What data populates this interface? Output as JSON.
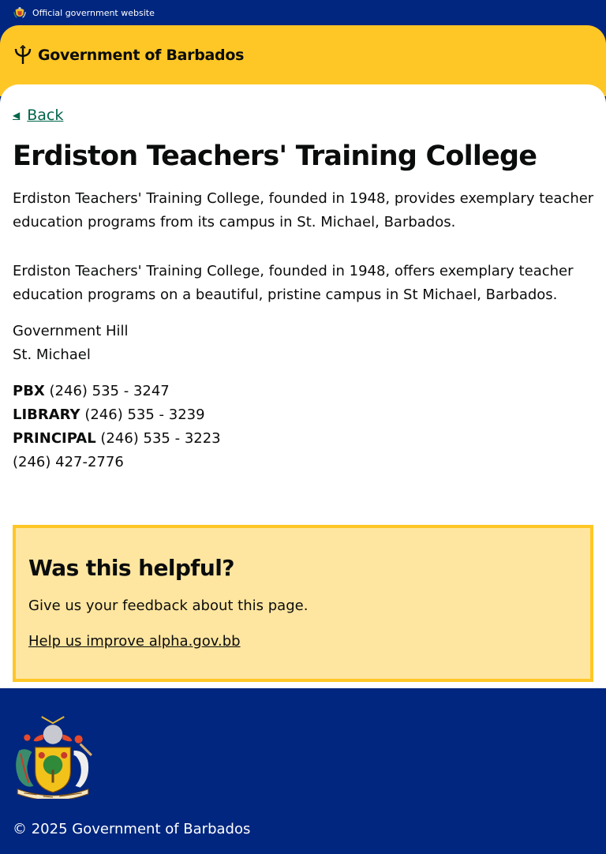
{
  "topbar": {
    "label": "Official government website",
    "icon": "coat-of-arms-icon"
  },
  "header": {
    "brand": "Government of Barbados",
    "icon": "trident-icon"
  },
  "nav": {
    "back_label": "Back"
  },
  "page": {
    "title": "Erdiston Teachers' Training College",
    "summary": "Erdiston Teachers' Training College, founded in 1948, provides exemplary teacher education programs from its campus in St. Michael, Barbados.",
    "description": "Erdiston Teachers' Training College, founded in 1948, offers exemplary teacher education programs on a beautiful, pristine campus in St Michael, Barbados.",
    "address": [
      "Government Hill",
      "St. Michael"
    ],
    "phones": [
      {
        "label": "PBX",
        "number": "(246) 535 - 3247"
      },
      {
        "label": "LIBRARY",
        "number": "(246) 535 - 3239"
      },
      {
        "label": "PRINCIPAL",
        "number": "(246) 535 - 3223"
      },
      {
        "label": "",
        "number": "(246) 427-2776"
      }
    ]
  },
  "feedback": {
    "heading": "Was this helpful?",
    "text": "Give us your feedback about this page.",
    "link": "Help us improve alpha.gov.bb"
  },
  "footer": {
    "copyright": "© 2025 Government of Barbados",
    "icon": "coat-of-arms-icon"
  },
  "colors": {
    "navy": "#00267f",
    "gold": "#ffc726",
    "feedback_bg": "#ffe6a0",
    "link_green": "#00654a"
  }
}
